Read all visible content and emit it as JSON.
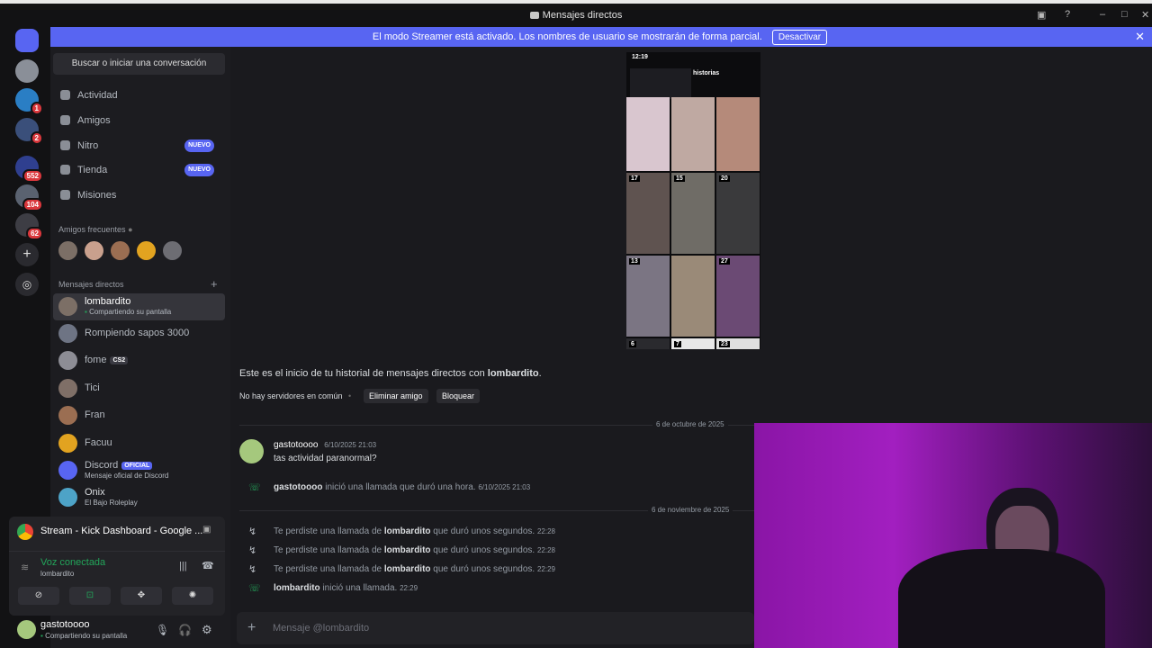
{
  "window": {
    "title": "Mensajes directos"
  },
  "banner": {
    "text": "El modo Streamer está activado. Los nombres de usuario se mostrarán de forma parcial.",
    "button": "Desactivar",
    "close": "✕"
  },
  "servers": [
    {
      "color": "#5865f2",
      "badge": ""
    },
    {
      "color": "#8a8f98",
      "badge": ""
    },
    {
      "color": "#2a7ec4",
      "badge": "1"
    },
    {
      "color": "#3a4f7a",
      "badge": "2"
    },
    {
      "color": "#2f3f8f",
      "badge": "552"
    },
    {
      "color": "#5a6270",
      "badge": "104"
    },
    {
      "color": "#3d3d44",
      "badge": "62"
    }
  ],
  "sidebar": {
    "search": "Buscar o iniciar una conversación",
    "nav": [
      {
        "label": "Actividad",
        "badge": ""
      },
      {
        "label": "Amigos",
        "badge": ""
      },
      {
        "label": "Nitro",
        "badge": "NUEVO"
      },
      {
        "label": "Tienda",
        "badge": "NUEVO"
      },
      {
        "label": "Misiones",
        "badge": ""
      }
    ],
    "frequent_title": "Amigos frecuentes",
    "dm_title": "Mensajes directos",
    "dms": [
      {
        "name": "lombardito",
        "sub": "Compartiendo su pantalla",
        "tag": "",
        "color": "#7c6f66"
      },
      {
        "name": "Rompiendo sapos 3000",
        "sub": "",
        "tag": "",
        "color": "#6e7484"
      },
      {
        "name": "fome",
        "sub": "",
        "tag": "CS2",
        "color": "#8d8d95"
      },
      {
        "name": "Tici",
        "sub": "",
        "tag": "",
        "color": "#7f6f67"
      },
      {
        "name": "Fran",
        "sub": "",
        "tag": "",
        "color": "#9b6e52"
      },
      {
        "name": "Facuu",
        "sub": "",
        "tag": "",
        "color": "#e2a320"
      },
      {
        "name": "Discord",
        "sub": "Mensaje oficial de Discord",
        "tag": "OFICIAL",
        "color": "#5865f2"
      },
      {
        "name": "Onix",
        "sub": "El Bajo Roleplay",
        "tag": "",
        "color": "#4da3c7"
      }
    ],
    "stream_title": "Stream - Kick Dashboard - Google ...",
    "voice": "Voz conectada",
    "voice_user": "lombardito",
    "user": "gastotoooo",
    "user_status": "Compartiendo su pantalla"
  },
  "main": {
    "phone_time": "12:19",
    "phone_title": "historias",
    "phone_dates": [
      "17",
      "15",
      "20",
      "13",
      "",
      "27",
      "6",
      "7",
      "23"
    ],
    "intro_prefix": "Este es el inicio de tu historial de mensajes directos con ",
    "intro_user": "lombardito",
    "no_servers": "No hay servidores en común",
    "remove_friend": "Eliminar amigo",
    "block": "Bloquear",
    "divider1": "6 de octubre de 2025",
    "divider2": "6 de noviembre de 2025",
    "msg_author": "gastotoooo",
    "msg_time": "6/10/2025 21:03",
    "msg_text": "tas actividad paranormal?",
    "call1_text": " inició una llamada que duró una hora.",
    "call1_time": "6/10/2025 21:03",
    "missed_prefix": "Te perdiste una llamada de ",
    "missed_user": "lombardito",
    "missed_suffix": " que duró unos segundos.",
    "missed_times": [
      "22:28",
      "22:28",
      "22:29"
    ],
    "last_call_text": " inició una llamada.",
    "last_call_time": "22:29",
    "composer": "Mensaje @lombardito"
  }
}
